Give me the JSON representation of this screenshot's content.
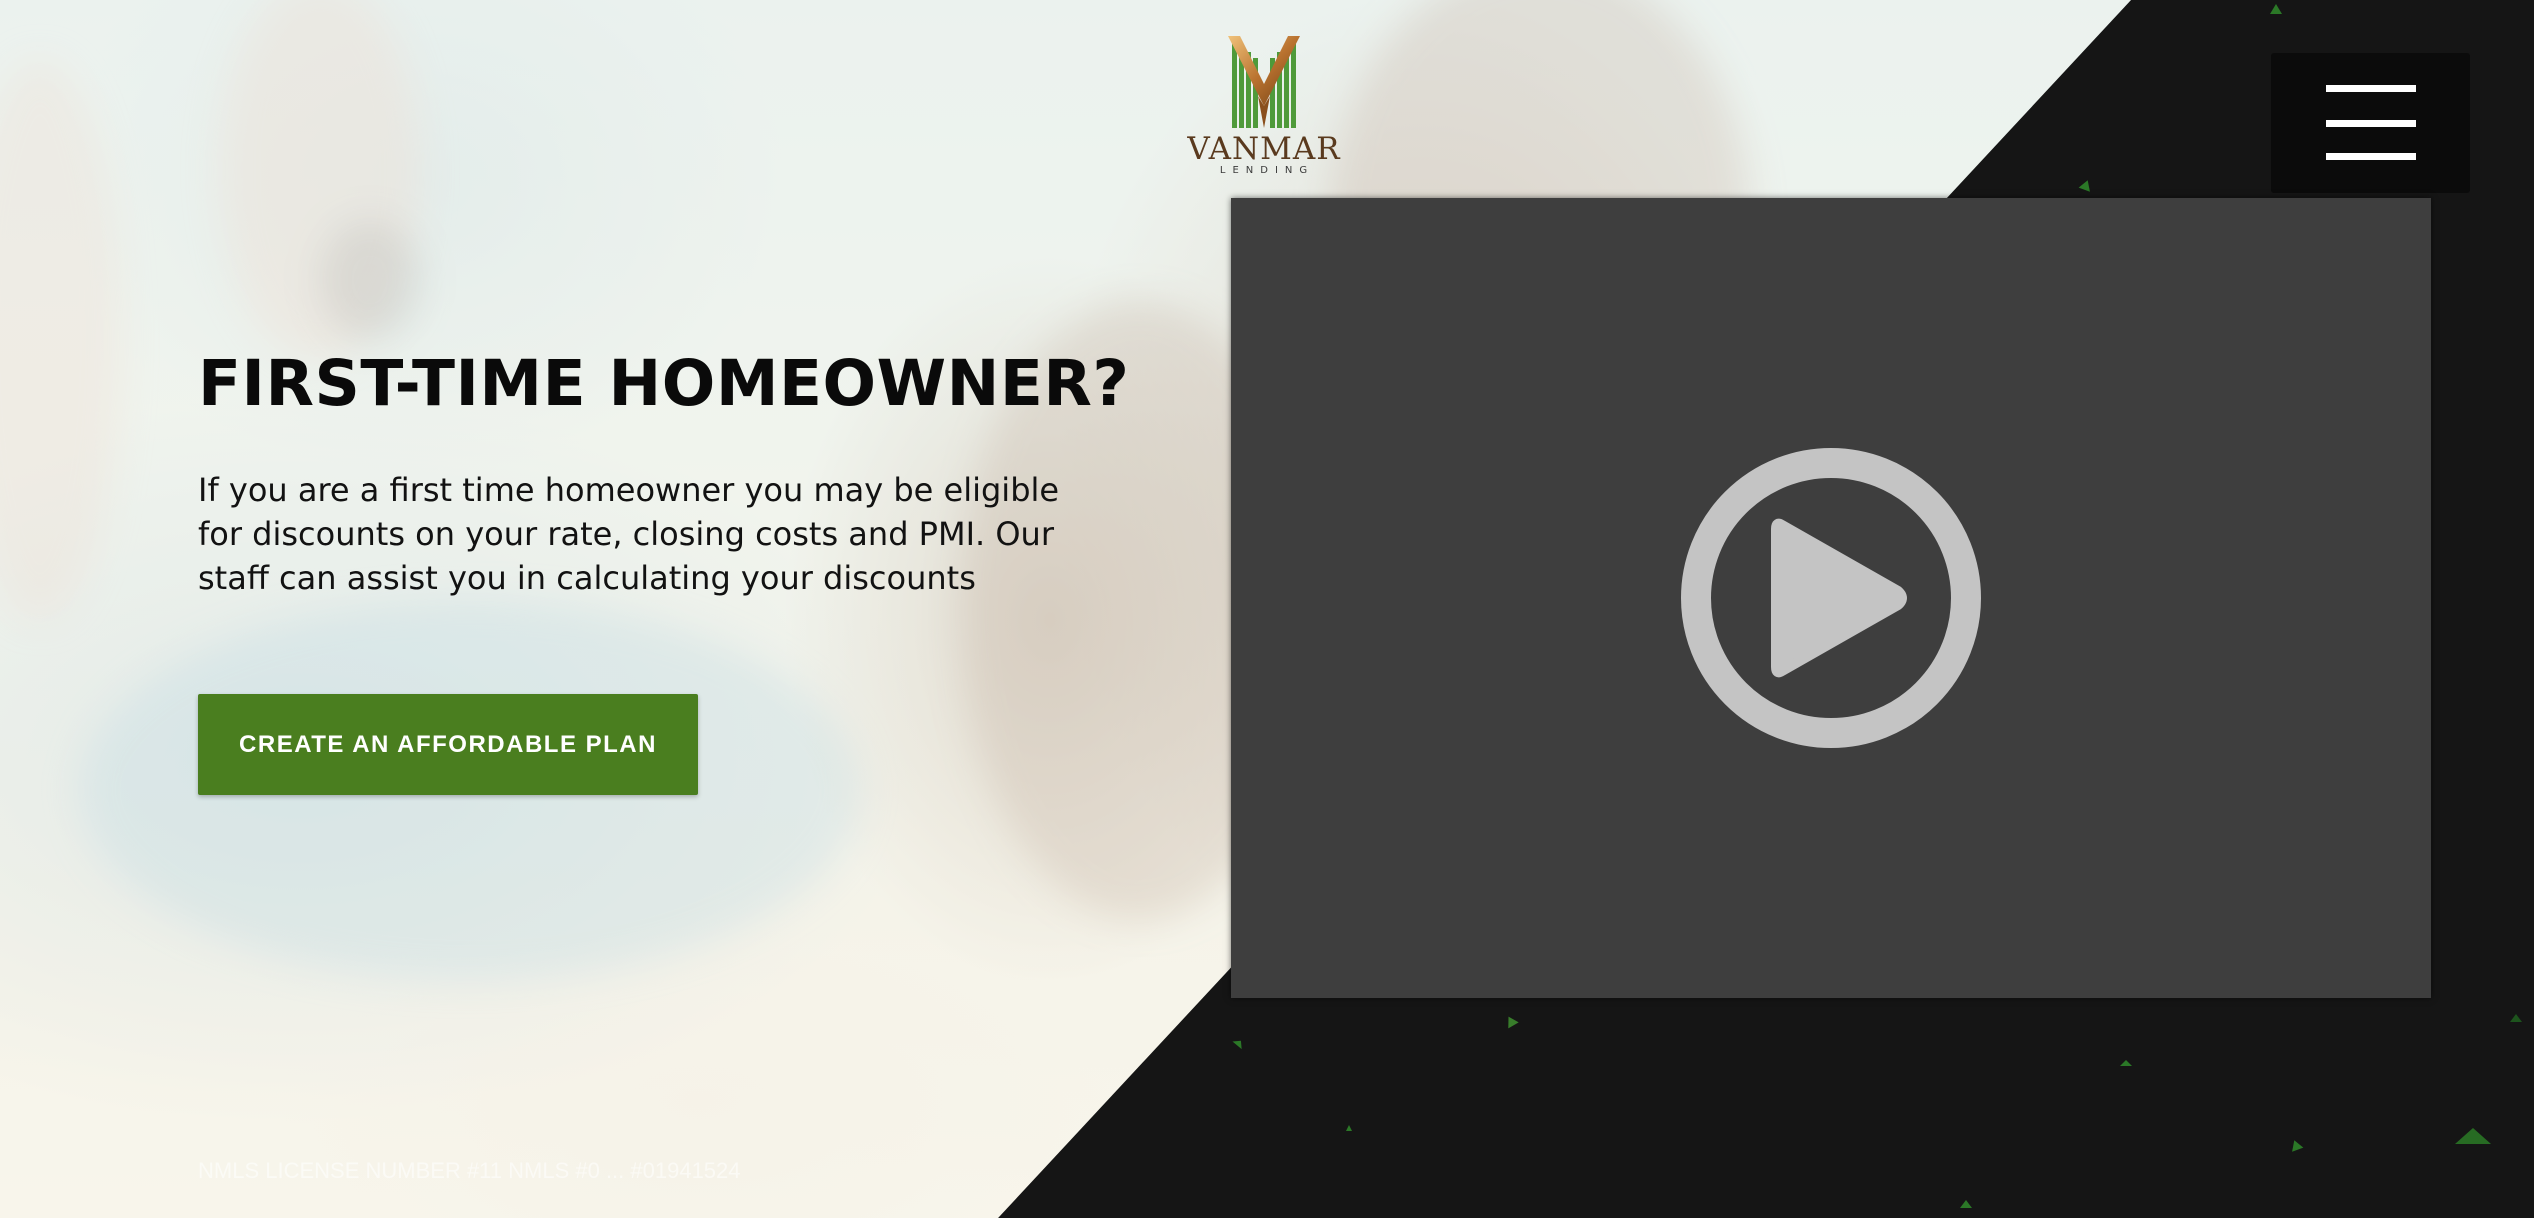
{
  "brand": {
    "name": "VANMAR",
    "subname": "LENDING"
  },
  "menu": {
    "icon": "hamburger-menu-icon"
  },
  "hero": {
    "headline": "FIRST-TIME HOMEOWNER?",
    "body": "If you are a first time homeowner you may be eligible for discounts on your rate, closing costs and PMI. Our staff can assist you in calculating your discounts",
    "cta_label": "CREATE AN AFFORDABLE PLAN"
  },
  "footer": {
    "license": "NMLS LICENSE NUMBER #11 NMLS #0 ... #01941524"
  },
  "video": {
    "icon": "play-icon"
  },
  "colors": {
    "accent_green": "#4a7e1f",
    "dark_panel": "#151515",
    "video_bg": "#3e3e3e",
    "play_icon": "#c4c4c4",
    "logo_brown": "#5a3a1e"
  }
}
